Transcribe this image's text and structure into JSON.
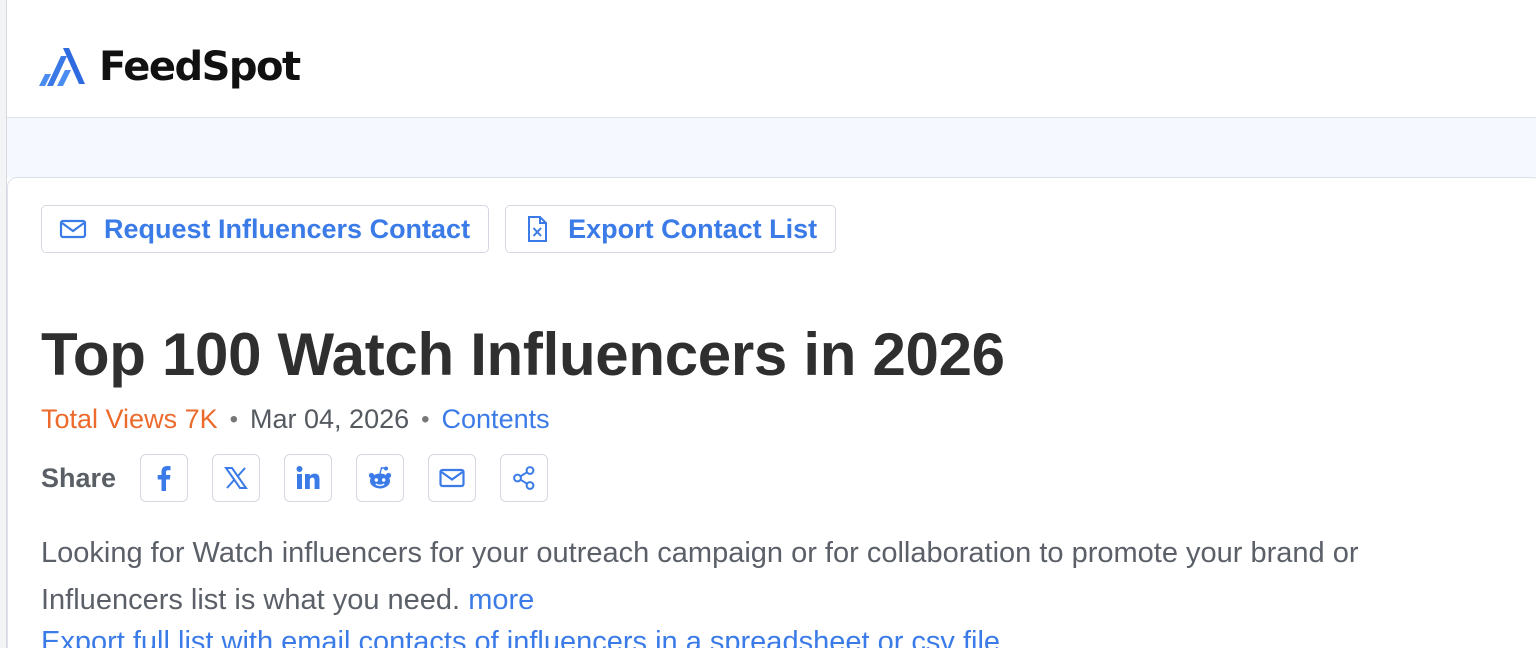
{
  "brand": {
    "name": "FeedSpot",
    "accent": "#3b7be8",
    "logo_icon": "feedspot-logo-icon"
  },
  "toolbar": {
    "request_contact_label": "Request Influencers Contact",
    "request_contact_icon": "mail-icon",
    "export_contact_label": "Export Contact List",
    "export_contact_icon": "excel-file-icon"
  },
  "article": {
    "title": "Top 100 Watch Influencers in 2026",
    "total_views": "Total Views 7K",
    "date": "Mar 04, 2026",
    "contents_link": "Contents",
    "views_color": "#ec6a2c"
  },
  "share": {
    "label": "Share",
    "buttons": [
      {
        "icon": "facebook-icon"
      },
      {
        "icon": "x-twitter-icon"
      },
      {
        "icon": "linkedin-icon"
      },
      {
        "icon": "reddit-icon"
      },
      {
        "icon": "email-icon"
      },
      {
        "icon": "share-icon"
      }
    ]
  },
  "description": {
    "line1": "Looking for Watch influencers for your outreach campaign or for collaboration to promote your brand or",
    "line2": "Influencers list is what you need.",
    "more": "more",
    "export_link": "Export full list with email contacts of influencers in a spreadsheet or csv file"
  }
}
